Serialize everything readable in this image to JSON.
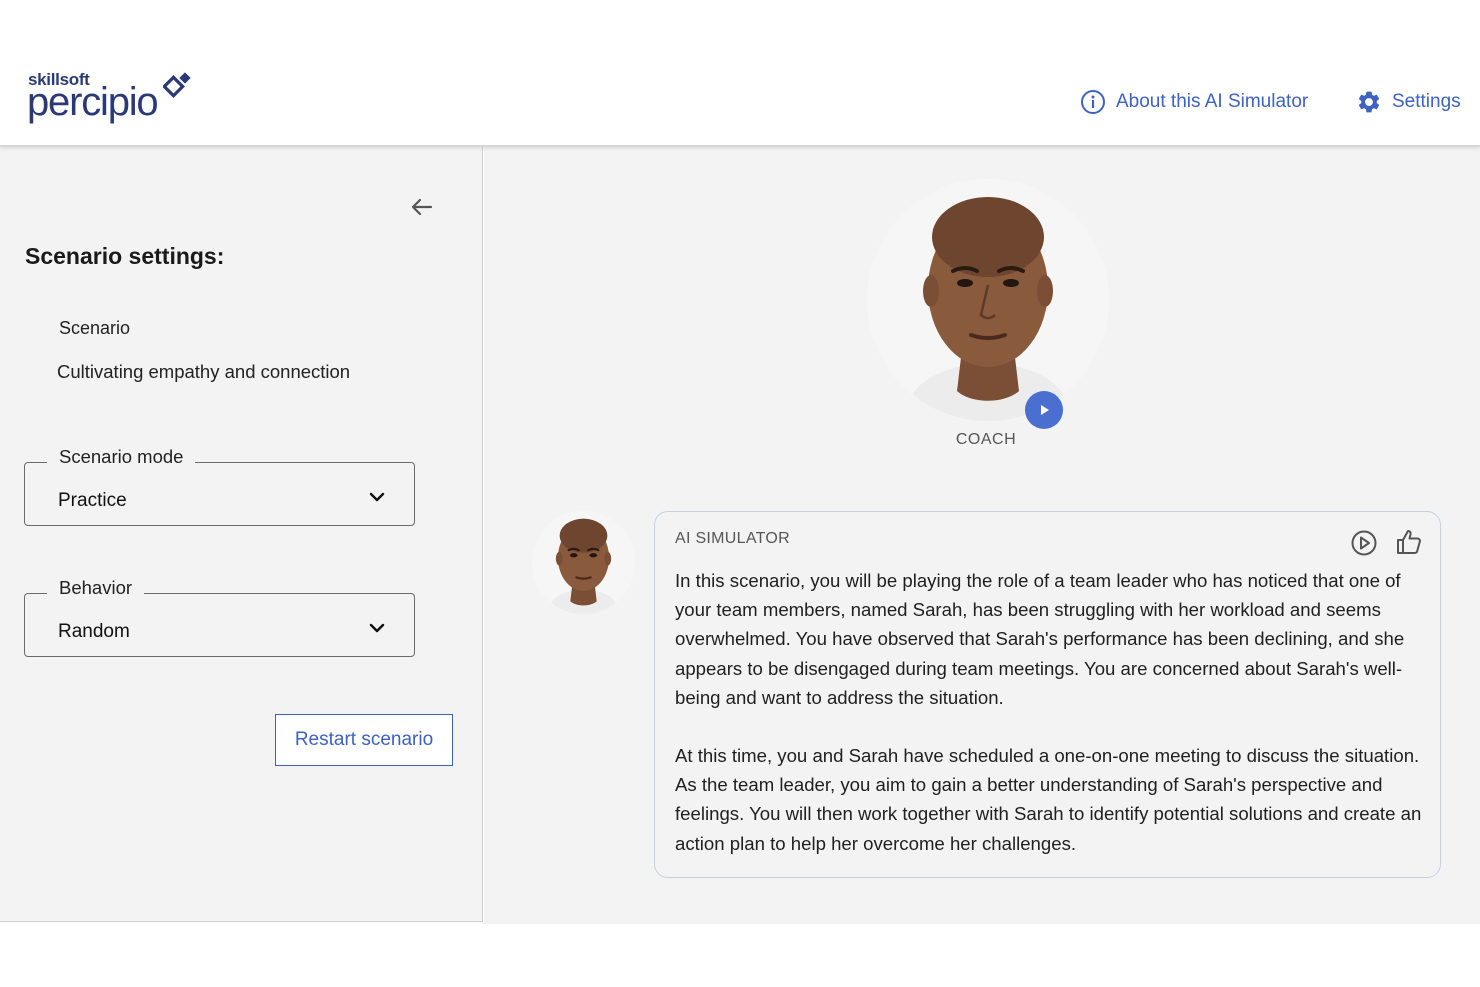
{
  "header": {
    "brand_small": "skillsoft",
    "brand_big": "percipio",
    "about_label": "About this AI Simulator",
    "settings_label": "Settings"
  },
  "sidebar": {
    "heading": "Scenario settings:",
    "scenario_label": "Scenario",
    "scenario_value": "Cultivating empathy and connection",
    "mode": {
      "label": "Scenario mode",
      "selected": "Practice"
    },
    "behavior": {
      "label": "Behavior",
      "selected": "Random"
    },
    "restart_label": "Restart scenario"
  },
  "main": {
    "coach_label": "COACH",
    "message": {
      "sender": "AI SIMULATOR",
      "paragraphs": [
        "In this scenario, you will be playing the role of a team leader who has noticed that one of your team members, named Sarah, has been struggling with her workload and seems overwhelmed. You have observed that Sarah's performance has been declining, and she appears to be disengaged during team meetings. You are concerned about Sarah's well-being and want to address the situation.",
        "At this time, you and Sarah have scheduled a one-on-one meeting to discuss the situation. As the team leader, you aim to gain a better understanding of Sarah's perspective and feelings. You will then work together with Sarah to identify potential solutions and create an action plan to help her overcome her challenges."
      ]
    }
  },
  "colors": {
    "accent": "#3d62c4",
    "brand": "#2b3a74",
    "play_badge": "#4a6fd1",
    "panel_bg": "#f3f3f3"
  },
  "icons": {
    "about": "info-circle-icon",
    "settings": "gear-icon",
    "back": "arrow-left-icon",
    "dropdown": "chevron-down-icon",
    "play": "play-icon",
    "like": "thumbs-up-icon"
  }
}
